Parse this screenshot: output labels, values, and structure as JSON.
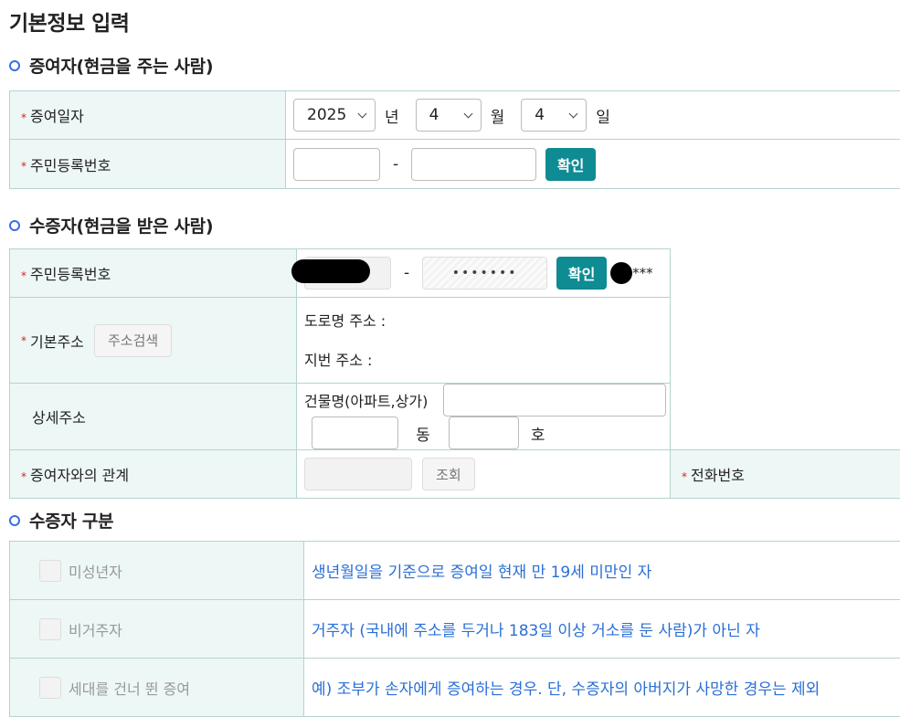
{
  "page_title": "기본정보 입력",
  "donor": {
    "title": "증여자(현금을 주는 사람)",
    "date_label": "증여일자",
    "year": "2025",
    "year_unit": "년",
    "month": "4",
    "month_unit": "월",
    "day": "4",
    "day_unit": "일",
    "rrn_label": "주민등록번호",
    "dash": "-",
    "confirm_label": "확인"
  },
  "recipient": {
    "title": "수증자(현금을 받은 사람)",
    "rrn_label": "주민등록번호",
    "dash": "-",
    "rrn_back_masked": "•••••••",
    "confirm_label": "확인",
    "masked_name_suffix": "***",
    "address_label": "기본주소",
    "address_search_label": "주소검색",
    "road_address_label": "도로명 주소 :",
    "lot_address_label": "지번 주소 :",
    "detail_label": "상세주소",
    "building_label": "건물명(아파트,상가)",
    "dong_unit": "동",
    "ho_unit": "호",
    "relation_label": "증여자와의 관계",
    "lookup_label": "조회",
    "phone_label": "전화번호"
  },
  "category": {
    "title": "수증자 구분",
    "rows": [
      {
        "label": "미성년자",
        "desc": "생년월일을 기준으로 증여일 현재 만 19세 미만인 자"
      },
      {
        "label": "비거주자",
        "desc": "거주자 (국내에 주소를 두거나 183일 이상 거소를 둔 사람)가 아닌 자"
      },
      {
        "label": "세대를 건너 뛴 증여",
        "desc": "예) 조부가 손자에게 증여하는 경우. 단, 수증자의 아버지가 사망한 경우는 제외"
      }
    ]
  },
  "required_mark": "*",
  "colors": {
    "accent": "#0e8b93",
    "label_bg": "#edf7f6",
    "required": "#d2222d",
    "desc_blue": "#2a6fd6",
    "bullet": "#3b6fe0"
  }
}
